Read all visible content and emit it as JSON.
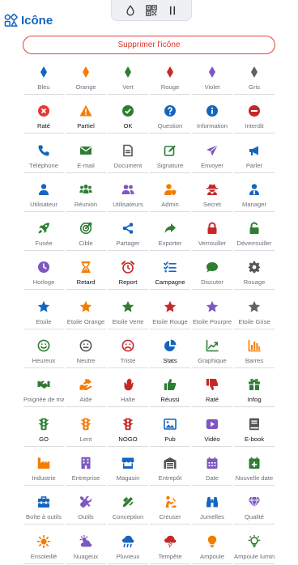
{
  "toolbar": {
    "items": [
      "drop-icon",
      "qrcode-icon",
      "pause-icon"
    ]
  },
  "header": {
    "title": "Icône",
    "icon": "icons-grid-icon",
    "color": "#1565c0"
  },
  "delete_button": {
    "label": "Supprimer l'icône",
    "color": "#e2453c"
  },
  "icons": [
    {
      "label": "Bleu",
      "icon": "diamond",
      "color": "#1565c0"
    },
    {
      "label": "Orange",
      "icon": "diamond",
      "color": "#f57c00"
    },
    {
      "label": "Vert",
      "icon": "diamond",
      "color": "#2e7d32"
    },
    {
      "label": "Rouge",
      "icon": "diamond",
      "color": "#c62828"
    },
    {
      "label": "Violet",
      "icon": "diamond",
      "color": "#7e57c2"
    },
    {
      "label": "Gris",
      "icon": "diamond",
      "color": "#616161"
    },
    {
      "label": "Raté",
      "icon": "x-circle",
      "color": "#e53935",
      "dark": true
    },
    {
      "label": "Partiel",
      "icon": "warning",
      "color": "#f57c00",
      "dark": true
    },
    {
      "label": "OK",
      "icon": "check-circle",
      "color": "#2e7d32",
      "dark": true
    },
    {
      "label": "Question",
      "icon": "question-circle",
      "color": "#1565c0"
    },
    {
      "label": "Information",
      "icon": "info-circle",
      "color": "#1565c0"
    },
    {
      "label": "Interdit",
      "icon": "minus-circle",
      "color": "#c62828"
    },
    {
      "label": "Téléphone",
      "icon": "phone",
      "color": "#1565c0"
    },
    {
      "label": "E-mail",
      "icon": "envelope",
      "color": "#2e7d32"
    },
    {
      "label": "Document",
      "icon": "document",
      "color": "#555555"
    },
    {
      "label": "Signature",
      "icon": "signature",
      "color": "#2e7d32"
    },
    {
      "label": "Envoyer",
      "icon": "send",
      "color": "#7e57c2"
    },
    {
      "label": "Parler",
      "icon": "megaphone",
      "color": "#1565c0"
    },
    {
      "label": "Utilisateur",
      "icon": "user",
      "color": "#1565c0"
    },
    {
      "label": "Réunion",
      "icon": "users-three",
      "color": "#2e7d32"
    },
    {
      "label": "Utilisateurs",
      "icon": "users-two",
      "color": "#7e57c2"
    },
    {
      "label": "Admin",
      "icon": "user-admin",
      "color": "#f57c00"
    },
    {
      "label": "Secret",
      "icon": "user-secret",
      "color": "#c62828"
    },
    {
      "label": "Manager",
      "icon": "user-tie",
      "color": "#1565c0"
    },
    {
      "label": "Fusée",
      "icon": "rocket",
      "color": "#2e7d32"
    },
    {
      "label": "Cible",
      "icon": "target",
      "color": "#2e7d32"
    },
    {
      "label": "Partager",
      "icon": "share",
      "color": "#1565c0"
    },
    {
      "label": "Exporter",
      "icon": "export-arrow",
      "color": "#2e7d32"
    },
    {
      "label": "Verrouiller",
      "icon": "lock",
      "color": "#c62828"
    },
    {
      "label": "Déverrouiller",
      "icon": "unlock",
      "color": "#2e7d32"
    },
    {
      "label": "Horloge",
      "icon": "clock",
      "color": "#7e57c2"
    },
    {
      "label": "Retard",
      "icon": "hourglass",
      "color": "#f57c00",
      "dark": true
    },
    {
      "label": "Report",
      "icon": "alarm",
      "color": "#c62828",
      "dark": true
    },
    {
      "label": "Campagne",
      "icon": "checklist",
      "color": "#1565c0",
      "dark": true
    },
    {
      "label": "Discuter",
      "icon": "chat",
      "color": "#2e7d32"
    },
    {
      "label": "Rouage",
      "icon": "gear",
      "color": "#555555"
    },
    {
      "label": "Etoile",
      "icon": "star",
      "color": "#1565c0"
    },
    {
      "label": "Etoile Orange",
      "icon": "star",
      "color": "#f57c00"
    },
    {
      "label": "Etoile Verte",
      "icon": "star",
      "color": "#2e7d32"
    },
    {
      "label": "Etoile Rouge",
      "icon": "star",
      "color": "#c62828"
    },
    {
      "label": "Etoile Pourpre",
      "icon": "star",
      "color": "#7e57c2"
    },
    {
      "label": "Etoile Grise",
      "icon": "star",
      "color": "#616161"
    },
    {
      "label": "Heureux",
      "icon": "smile",
      "color": "#2e7d32"
    },
    {
      "label": "Neutre",
      "icon": "neutral",
      "color": "#555555"
    },
    {
      "label": "Triste",
      "icon": "sad",
      "color": "#c62828"
    },
    {
      "label": "Stats",
      "icon": "pie-chart",
      "color": "#1565c0",
      "dark": true
    },
    {
      "label": "Graphique",
      "icon": "line-chart",
      "color": "#2e7d32"
    },
    {
      "label": "Barres",
      "icon": "bar-chart",
      "color": "#f57c00"
    },
    {
      "label": "Poignée de main",
      "icon": "handshake",
      "color": "#2e7d32"
    },
    {
      "label": "Aide",
      "icon": "hands-helping",
      "color": "#f57c00"
    },
    {
      "label": "Halte",
      "icon": "hand-stop",
      "color": "#c62828"
    },
    {
      "label": "Réussi",
      "icon": "thumbs-up",
      "color": "#2e7d32",
      "dark": true
    },
    {
      "label": "Raté",
      "icon": "thumbs-down",
      "color": "#c62828",
      "dark": true
    },
    {
      "label": "Infog",
      "icon": "gift",
      "color": "#2e7d32",
      "dark": true
    },
    {
      "label": "GO",
      "icon": "traffic-light",
      "color": "#2e7d32",
      "dark": true
    },
    {
      "label": "Lent",
      "icon": "traffic-light",
      "color": "#f57c00"
    },
    {
      "label": "NOGO",
      "icon": "traffic-light",
      "color": "#c62828",
      "dark": true
    },
    {
      "label": "Pub",
      "icon": "picture",
      "color": "#1565c0",
      "dark": true
    },
    {
      "label": "Vidéo",
      "icon": "video",
      "color": "#7e57c2",
      "dark": true
    },
    {
      "label": "E-book",
      "icon": "book",
      "color": "#555555",
      "dark": true
    },
    {
      "label": "Industrie",
      "icon": "industry",
      "color": "#f57c00"
    },
    {
      "label": "Entreprise",
      "icon": "building",
      "color": "#7e57c2"
    },
    {
      "label": "Magasin",
      "icon": "store",
      "color": "#1565c0"
    },
    {
      "label": "Entrepôt",
      "icon": "warehouse",
      "color": "#555555"
    },
    {
      "label": "Date",
      "icon": "calendar",
      "color": "#7e57c2"
    },
    {
      "label": "Nouvelle date",
      "icon": "calendar-plus",
      "color": "#2e7d32"
    },
    {
      "label": "Boîte à outils",
      "icon": "toolbox",
      "color": "#1565c0"
    },
    {
      "label": "Outils",
      "icon": "tools",
      "color": "#7e57c2"
    },
    {
      "label": "Conception",
      "icon": "design",
      "color": "#2e7d32"
    },
    {
      "label": "Creuser",
      "icon": "dig",
      "color": "#f57c00"
    },
    {
      "label": "Jumelles",
      "icon": "binoculars",
      "color": "#1565c0"
    },
    {
      "label": "Qualité",
      "icon": "gem",
      "color": "#7e57c2"
    },
    {
      "label": "Ensoleillé",
      "icon": "sun",
      "color": "#f57c00"
    },
    {
      "label": "Nuageux",
      "icon": "cloud-sun",
      "color": "#7e57c2"
    },
    {
      "label": "Pluvieux",
      "icon": "cloud-rain",
      "color": "#1565c0"
    },
    {
      "label": "Tempête",
      "icon": "storm",
      "color": "#c62828"
    },
    {
      "label": "Ampoule",
      "icon": "bulb",
      "color": "#f57c00"
    },
    {
      "label": "Ampoule lumineuse",
      "icon": "bulb-lit",
      "color": "#2e7d32"
    }
  ]
}
